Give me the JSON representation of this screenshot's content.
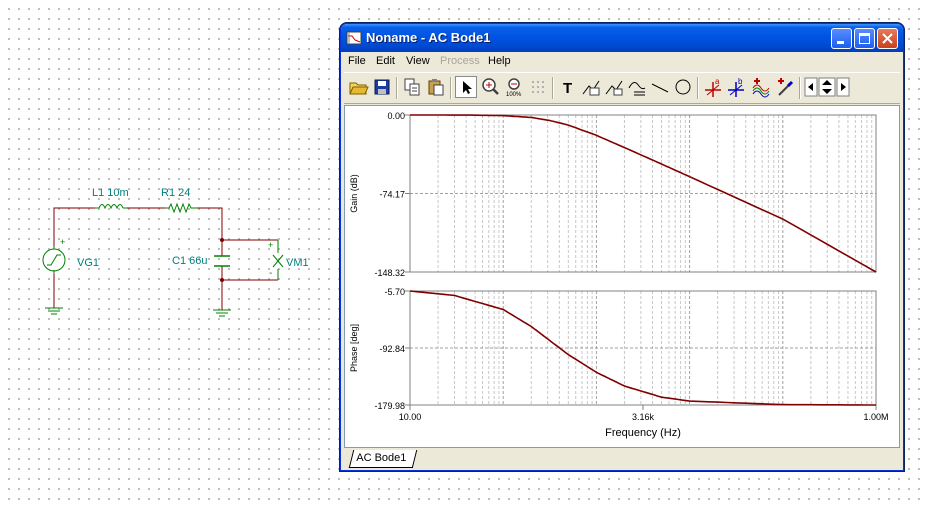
{
  "schematic": {
    "components": {
      "L1": "L1 10m",
      "R1": "R1 24",
      "C1": "C1 66u",
      "VG1": "VG1",
      "VM1": "VM1"
    },
    "polarity": {
      "plus": "+",
      "minus": "-"
    }
  },
  "window": {
    "title": "Noname - AC Bode1",
    "menu": [
      "File",
      "Edit",
      "View",
      "Process",
      "Help"
    ],
    "menu_disabled": [
      "Process"
    ],
    "toolbar_icons": [
      "open-folder-icon",
      "save-disk-icon",
      "copy-icon",
      "paste-icon",
      "select-arrow-icon",
      "zoom-in-icon",
      "zoom-100-icon",
      "grid-icon",
      "text-tool-icon",
      "label-tool-a-icon",
      "label-tool-b-icon",
      "label-tool-c-icon",
      "line-tool-icon",
      "ellipse-tool-icon",
      "cursor-a-icon",
      "cursor-b-icon",
      "add-curve-icon",
      "edit-curve-icon",
      "scroll-left-icon",
      "scroll-updown-icon",
      "scroll-right-icon"
    ],
    "toolbar_icon_text": {
      "text_tool": "T",
      "zoom100": "100%",
      "cursor_a": "a",
      "cursor_b": "b"
    },
    "tab": "AC Bode1"
  },
  "chart_data": [
    {
      "type": "line",
      "ylabel": "Gain (dB)",
      "xscale": "log",
      "xlim": [
        10,
        1000000
      ],
      "ylim": [
        -148.32,
        0.0
      ],
      "yticks": [
        "0.00",
        "-74.17",
        "-148.32"
      ],
      "color": "#800000",
      "series": [
        {
          "x": [
            10,
            20,
            50,
            100,
            200,
            316,
            500,
            1000,
            2000,
            5000,
            10000,
            100000,
            1000000
          ],
          "y": [
            -0.001,
            -0.02,
            -0.15,
            -0.6,
            -2.3,
            -5.2,
            -9.5,
            -19.2,
            -30.8,
            -46.3,
            -58.3,
            -98.3,
            -148.32
          ]
        }
      ],
      "grid": true
    },
    {
      "type": "line",
      "ylabel": "Phase [deg]",
      "xlabel": "Frequency (Hz)",
      "xscale": "log",
      "xlim": [
        10,
        1000000
      ],
      "ylim": [
        -179.98,
        -5.7
      ],
      "xticks": [
        "10.00",
        "3.16k",
        "1.00M"
      ],
      "yticks": [
        "-5.70",
        "-92.84",
        "-179.98"
      ],
      "color": "#800000",
      "series": [
        {
          "x": [
            10,
            30,
            100,
            200,
            300,
            500,
            1000,
            2000,
            5000,
            10000,
            100000,
            1000000
          ],
          "y": [
            -5.7,
            -12.5,
            -34.0,
            -60.0,
            -79.0,
            -103.0,
            -130.0,
            -151.0,
            -168.0,
            -174.0,
            -179.4,
            -179.98
          ]
        }
      ],
      "grid": true
    }
  ]
}
